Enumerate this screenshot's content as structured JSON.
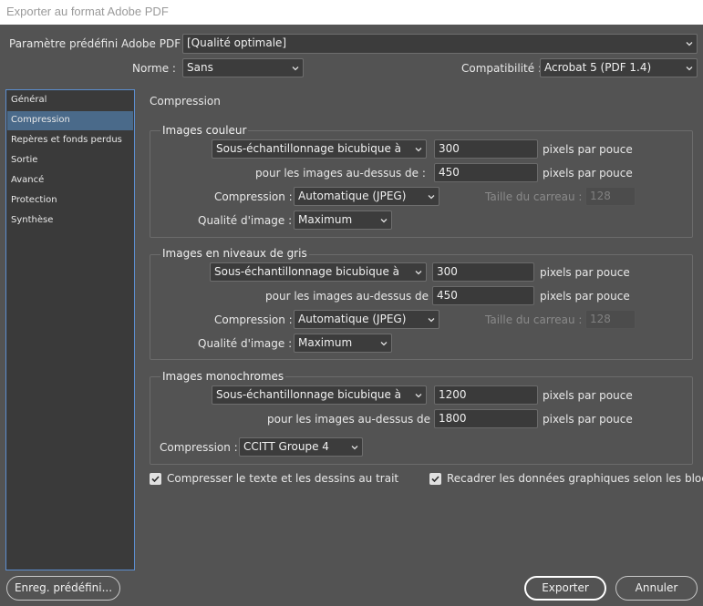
{
  "window": {
    "title": "Exporter au format Adobe PDF"
  },
  "preset": {
    "label": "Paramètre prédéfini Adobe PDF :",
    "value": "[Qualité optimale]"
  },
  "standard": {
    "label": "Norme :",
    "value": "Sans"
  },
  "compat": {
    "label": "Compatibilité :",
    "value": "Acrobat 5 (PDF 1.4)"
  },
  "sidebar": {
    "items": [
      {
        "label": "Général"
      },
      {
        "label": "Compression"
      },
      {
        "label": "Repères et fonds perdus"
      },
      {
        "label": "Sortie"
      },
      {
        "label": "Avancé"
      },
      {
        "label": "Protection"
      },
      {
        "label": "Synthèse"
      }
    ],
    "selected": "Compression"
  },
  "panel": {
    "title": "Compression"
  },
  "color": {
    "title": "Images couleur",
    "sampling": "Sous-échantillonnage bicubique à",
    "ppi": "300",
    "ppi_unit": "pixels par pouce",
    "above_label": "pour les images au-dessus de :",
    "above": "450",
    "above_unit": "pixels par pouce",
    "compression_label": "Compression :",
    "compression": "Automatique (JPEG)",
    "tile_label": "Taille du carreau :",
    "tile": "128",
    "quality_label": "Qualité d'image :",
    "quality": "Maximum"
  },
  "gray": {
    "title": "Images en niveaux de gris",
    "sampling": "Sous-échantillonnage bicubique à",
    "ppi": "300",
    "ppi_unit": "pixels par pouce",
    "above_label": "pour les images au-dessus de :",
    "above": "450",
    "above_unit": "pixels par pouce",
    "compression_label": "Compression :",
    "compression": "Automatique (JPEG)",
    "tile_label": "Taille du carreau :",
    "tile": "128",
    "quality_label": "Qualité d'image :",
    "quality": "Maximum"
  },
  "mono": {
    "title": "Images monochromes",
    "sampling": "Sous-échantillonnage bicubique à",
    "ppi": "1200",
    "ppi_unit": "pixels par pouce",
    "above_label": "pour les images au-dessus de :",
    "above": "1800",
    "above_unit": "pixels par pouce",
    "compression_label": "Compression :",
    "compression": "CCITT Groupe 4"
  },
  "options": {
    "compress_text": {
      "label": "Compresser le texte et les dessins au trait",
      "checked": true
    },
    "crop_images": {
      "label": "Recadrer les données graphiques selon les blocs",
      "checked": true
    }
  },
  "buttons": {
    "save_preset": "Enreg. prédéfini...",
    "export": "Exporter",
    "cancel": "Annuler"
  },
  "icons": {
    "chevron": "chevron-down-icon",
    "check": "checkmark-icon"
  }
}
